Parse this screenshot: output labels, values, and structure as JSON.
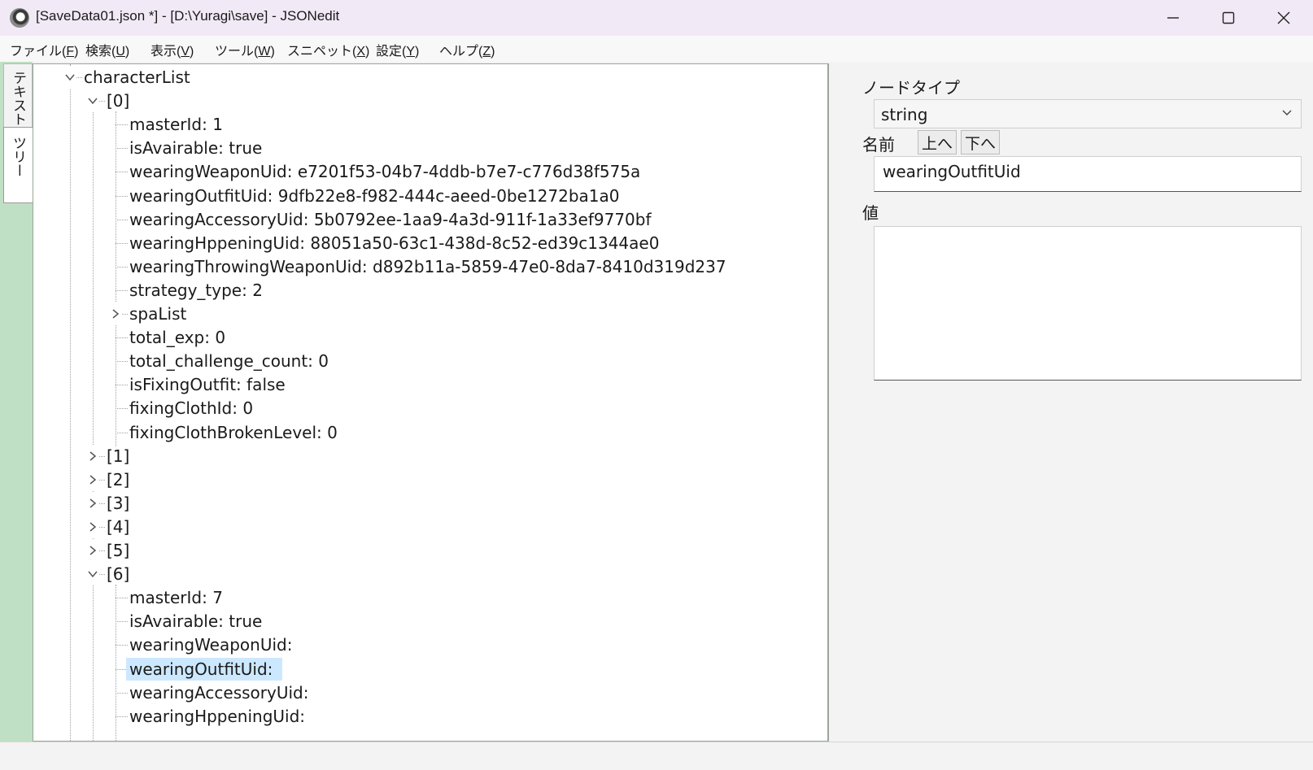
{
  "window": {
    "title": "[SaveData01.json *] - [D:\\Yuragi\\save] - JSONedit",
    "icons": {
      "app": "app-logo-icon",
      "minimize": "minimize-icon",
      "maximize": "maximize-icon",
      "close": "close-icon"
    }
  },
  "menu": {
    "items": [
      {
        "pre": "ファイル(",
        "key": "F",
        "post": ")"
      },
      {
        "pre": "検索(",
        "key": "U",
        "post": ")"
      },
      {
        "pre": "表示(",
        "key": "V",
        "post": ")"
      },
      {
        "pre": "ツール(",
        "key": "W",
        "post": ")"
      },
      {
        "pre": "スニペット(",
        "key": "X",
        "post": ")"
      },
      {
        "pre": "設定(",
        "key": "Y",
        "post": ")"
      },
      {
        "pre": "ヘルプ(",
        "key": "Z",
        "post": ")"
      }
    ]
  },
  "tabs": {
    "text": "テキスト",
    "tree": "ツリー"
  },
  "tree": {
    "rows": [
      {
        "text": "characterList"
      },
      {
        "text": "[0]"
      },
      {
        "text": "masterId: 1"
      },
      {
        "text": "isAvairable: true"
      },
      {
        "text": "wearingWeaponUid: e7201f53-04b7-4ddb-b7e7-c776d38f575a"
      },
      {
        "text": "wearingOutfitUid: 9dfb22e8-f982-444c-aeed-0be1272ba1a0"
      },
      {
        "text": "wearingAccessoryUid: 5b0792ee-1aa9-4a3d-911f-1a33ef9770bf"
      },
      {
        "text": "wearingHppeningUid: 88051a50-63c1-438d-8c52-ed39c1344ae0"
      },
      {
        "text": "wearingThrowingWeaponUid: d892b11a-5859-47e0-8da7-8410d319d237"
      },
      {
        "text": "strategy_type: 2"
      },
      {
        "text": "spaList"
      },
      {
        "text": "total_exp: 0"
      },
      {
        "text": "total_challenge_count: 0"
      },
      {
        "text": "isFixingOutfit: false"
      },
      {
        "text": "fixingClothId: 0"
      },
      {
        "text": "fixingClothBrokenLevel: 0"
      },
      {
        "text": "[1]"
      },
      {
        "text": "[2]"
      },
      {
        "text": "[3]"
      },
      {
        "text": "[4]"
      },
      {
        "text": "[5]"
      },
      {
        "text": "[6]"
      },
      {
        "text": "masterId: 7"
      },
      {
        "text": "isAvairable: true"
      },
      {
        "text": "wearingWeaponUid:"
      },
      {
        "text": "wearingOutfitUid:"
      },
      {
        "text": "wearingAccessoryUid:"
      },
      {
        "text": "wearingHppeningUid:"
      }
    ],
    "selected_row": "wearingOutfitUid:",
    "colors": {
      "selection": "#cce8ff"
    }
  },
  "props": {
    "nodetype_label": "ノードタイプ",
    "nodetype_value": "string",
    "name_label": "名前",
    "up_button": "上へ",
    "down_button": "下へ",
    "name_value": "wearingOutfitUid",
    "value_label": "値",
    "value_text": ""
  },
  "colors": {
    "title_bar": "#f1eaf6",
    "tab_strip": "#bfe0c4",
    "scroll_thumb": "#8a8a8a"
  }
}
